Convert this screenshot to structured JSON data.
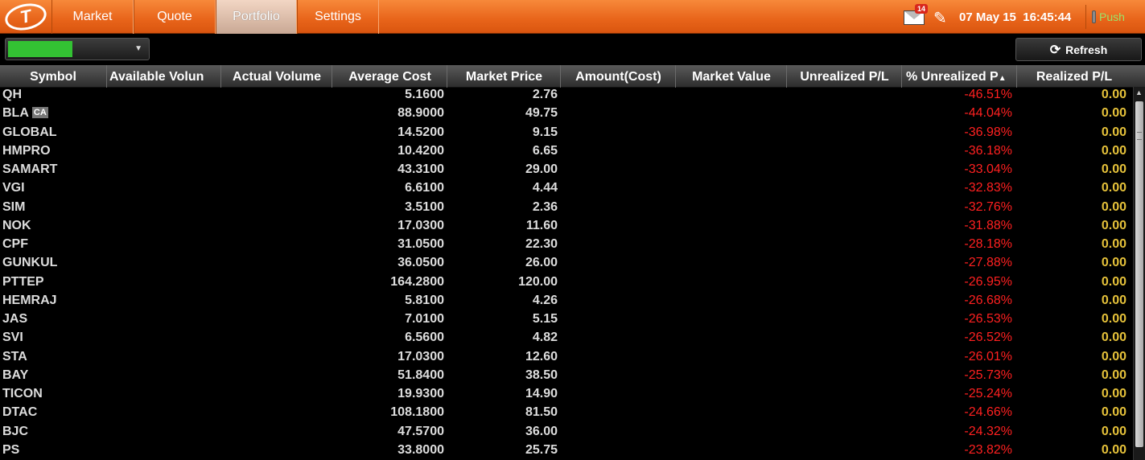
{
  "nav": {
    "logo_letter": "T",
    "tabs": [
      {
        "label": "Market"
      },
      {
        "label": "Quote"
      },
      {
        "label": "Portfolio"
      },
      {
        "label": "Settings"
      }
    ],
    "mail_count": "14",
    "date": "07 May 15",
    "time": "16:45:44",
    "push_label": "Push"
  },
  "toolbar": {
    "refresh_label": "Refresh",
    "account_color": "#33c233"
  },
  "table": {
    "headers": {
      "symbol": "Symbol",
      "available_volume": "Available Volun",
      "actual_volume": "Actual Volume",
      "average_cost": "Average Cost",
      "market_price": "Market Price",
      "amount_cost": "Amount(Cost)",
      "market_value": "Market Value",
      "unrealized_pl": "Unrealized P/L",
      "pct_unrealized": "% Unrealized P",
      "realized_pl": "Realized P/L"
    },
    "rows": [
      {
        "symbol": "QH",
        "avg": "5.1600",
        "mkt": "2.76",
        "pct": "-46.51%",
        "rpl": "0.00"
      },
      {
        "symbol": "BLA",
        "badge": "CA",
        "avg": "88.9000",
        "mkt": "49.75",
        "pct": "-44.04%",
        "rpl": "0.00"
      },
      {
        "symbol": "GLOBAL",
        "avg": "14.5200",
        "mkt": "9.15",
        "pct": "-36.98%",
        "rpl": "0.00"
      },
      {
        "symbol": "HMPRO",
        "avg": "10.4200",
        "mkt": "6.65",
        "pct": "-36.18%",
        "rpl": "0.00"
      },
      {
        "symbol": "SAMART",
        "avg": "43.3100",
        "mkt": "29.00",
        "pct": "-33.04%",
        "rpl": "0.00"
      },
      {
        "symbol": "VGI",
        "avg": "6.6100",
        "mkt": "4.44",
        "pct": "-32.83%",
        "rpl": "0.00"
      },
      {
        "symbol": "SIM",
        "avg": "3.5100",
        "mkt": "2.36",
        "pct": "-32.76%",
        "rpl": "0.00"
      },
      {
        "symbol": "NOK",
        "avg": "17.0300",
        "mkt": "11.60",
        "pct": "-31.88%",
        "rpl": "0.00"
      },
      {
        "symbol": "CPF",
        "avg": "31.0500",
        "mkt": "22.30",
        "pct": "-28.18%",
        "rpl": "0.00"
      },
      {
        "symbol": "GUNKUL",
        "avg": "36.0500",
        "mkt": "26.00",
        "pct": "-27.88%",
        "rpl": "0.00"
      },
      {
        "symbol": "PTTEP",
        "avg": "164.2800",
        "mkt": "120.00",
        "pct": "-26.95%",
        "rpl": "0.00"
      },
      {
        "symbol": "HEMRAJ",
        "avg": "5.8100",
        "mkt": "4.26",
        "pct": "-26.68%",
        "rpl": "0.00"
      },
      {
        "symbol": "JAS",
        "avg": "7.0100",
        "mkt": "5.15",
        "pct": "-26.53%",
        "rpl": "0.00"
      },
      {
        "symbol": "SVI",
        "avg": "6.5600",
        "mkt": "4.82",
        "pct": "-26.52%",
        "rpl": "0.00"
      },
      {
        "symbol": "STA",
        "avg": "17.0300",
        "mkt": "12.60",
        "pct": "-26.01%",
        "rpl": "0.00"
      },
      {
        "symbol": "BAY",
        "avg": "51.8400",
        "mkt": "38.50",
        "pct": "-25.73%",
        "rpl": "0.00"
      },
      {
        "symbol": "TICON",
        "avg": "19.9300",
        "mkt": "14.90",
        "pct": "-25.24%",
        "rpl": "0.00"
      },
      {
        "symbol": "DTAC",
        "avg": "108.1800",
        "mkt": "81.50",
        "pct": "-24.66%",
        "rpl": "0.00"
      },
      {
        "symbol": "BJC",
        "avg": "47.5700",
        "mkt": "36.00",
        "pct": "-24.32%",
        "rpl": "0.00"
      },
      {
        "symbol": "PS",
        "avg": "33.8000",
        "mkt": "25.75",
        "pct": "-23.82%",
        "rpl": "0.00"
      }
    ]
  },
  "colors": {
    "negative": "#ff2020",
    "realized": "#e6c23a",
    "accent": "#e8641a"
  }
}
